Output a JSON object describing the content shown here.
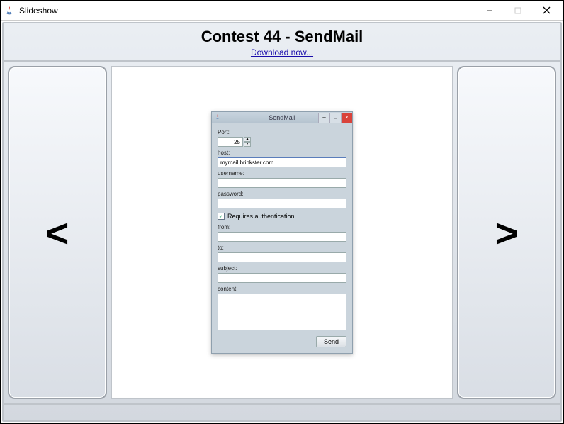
{
  "window": {
    "title": "Slideshow"
  },
  "header": {
    "title": "Contest 44 - SendMail",
    "download_link": "Download now..."
  },
  "nav": {
    "prev": "<",
    "next": ">"
  },
  "sendmail": {
    "window_title": "SendMail",
    "labels": {
      "port": "Port:",
      "host": "host:",
      "username": "username:",
      "password": "password:",
      "requires_auth": "Requires authentication",
      "from": "from:",
      "to": "to:",
      "subject": "subject:",
      "content": "content:"
    },
    "values": {
      "port": "25",
      "host": "mymail.brinkster.com",
      "username": "",
      "password": "",
      "requires_auth_checked": "✓",
      "from": "",
      "to": "",
      "subject": "",
      "content": ""
    },
    "send_button": "Send"
  }
}
